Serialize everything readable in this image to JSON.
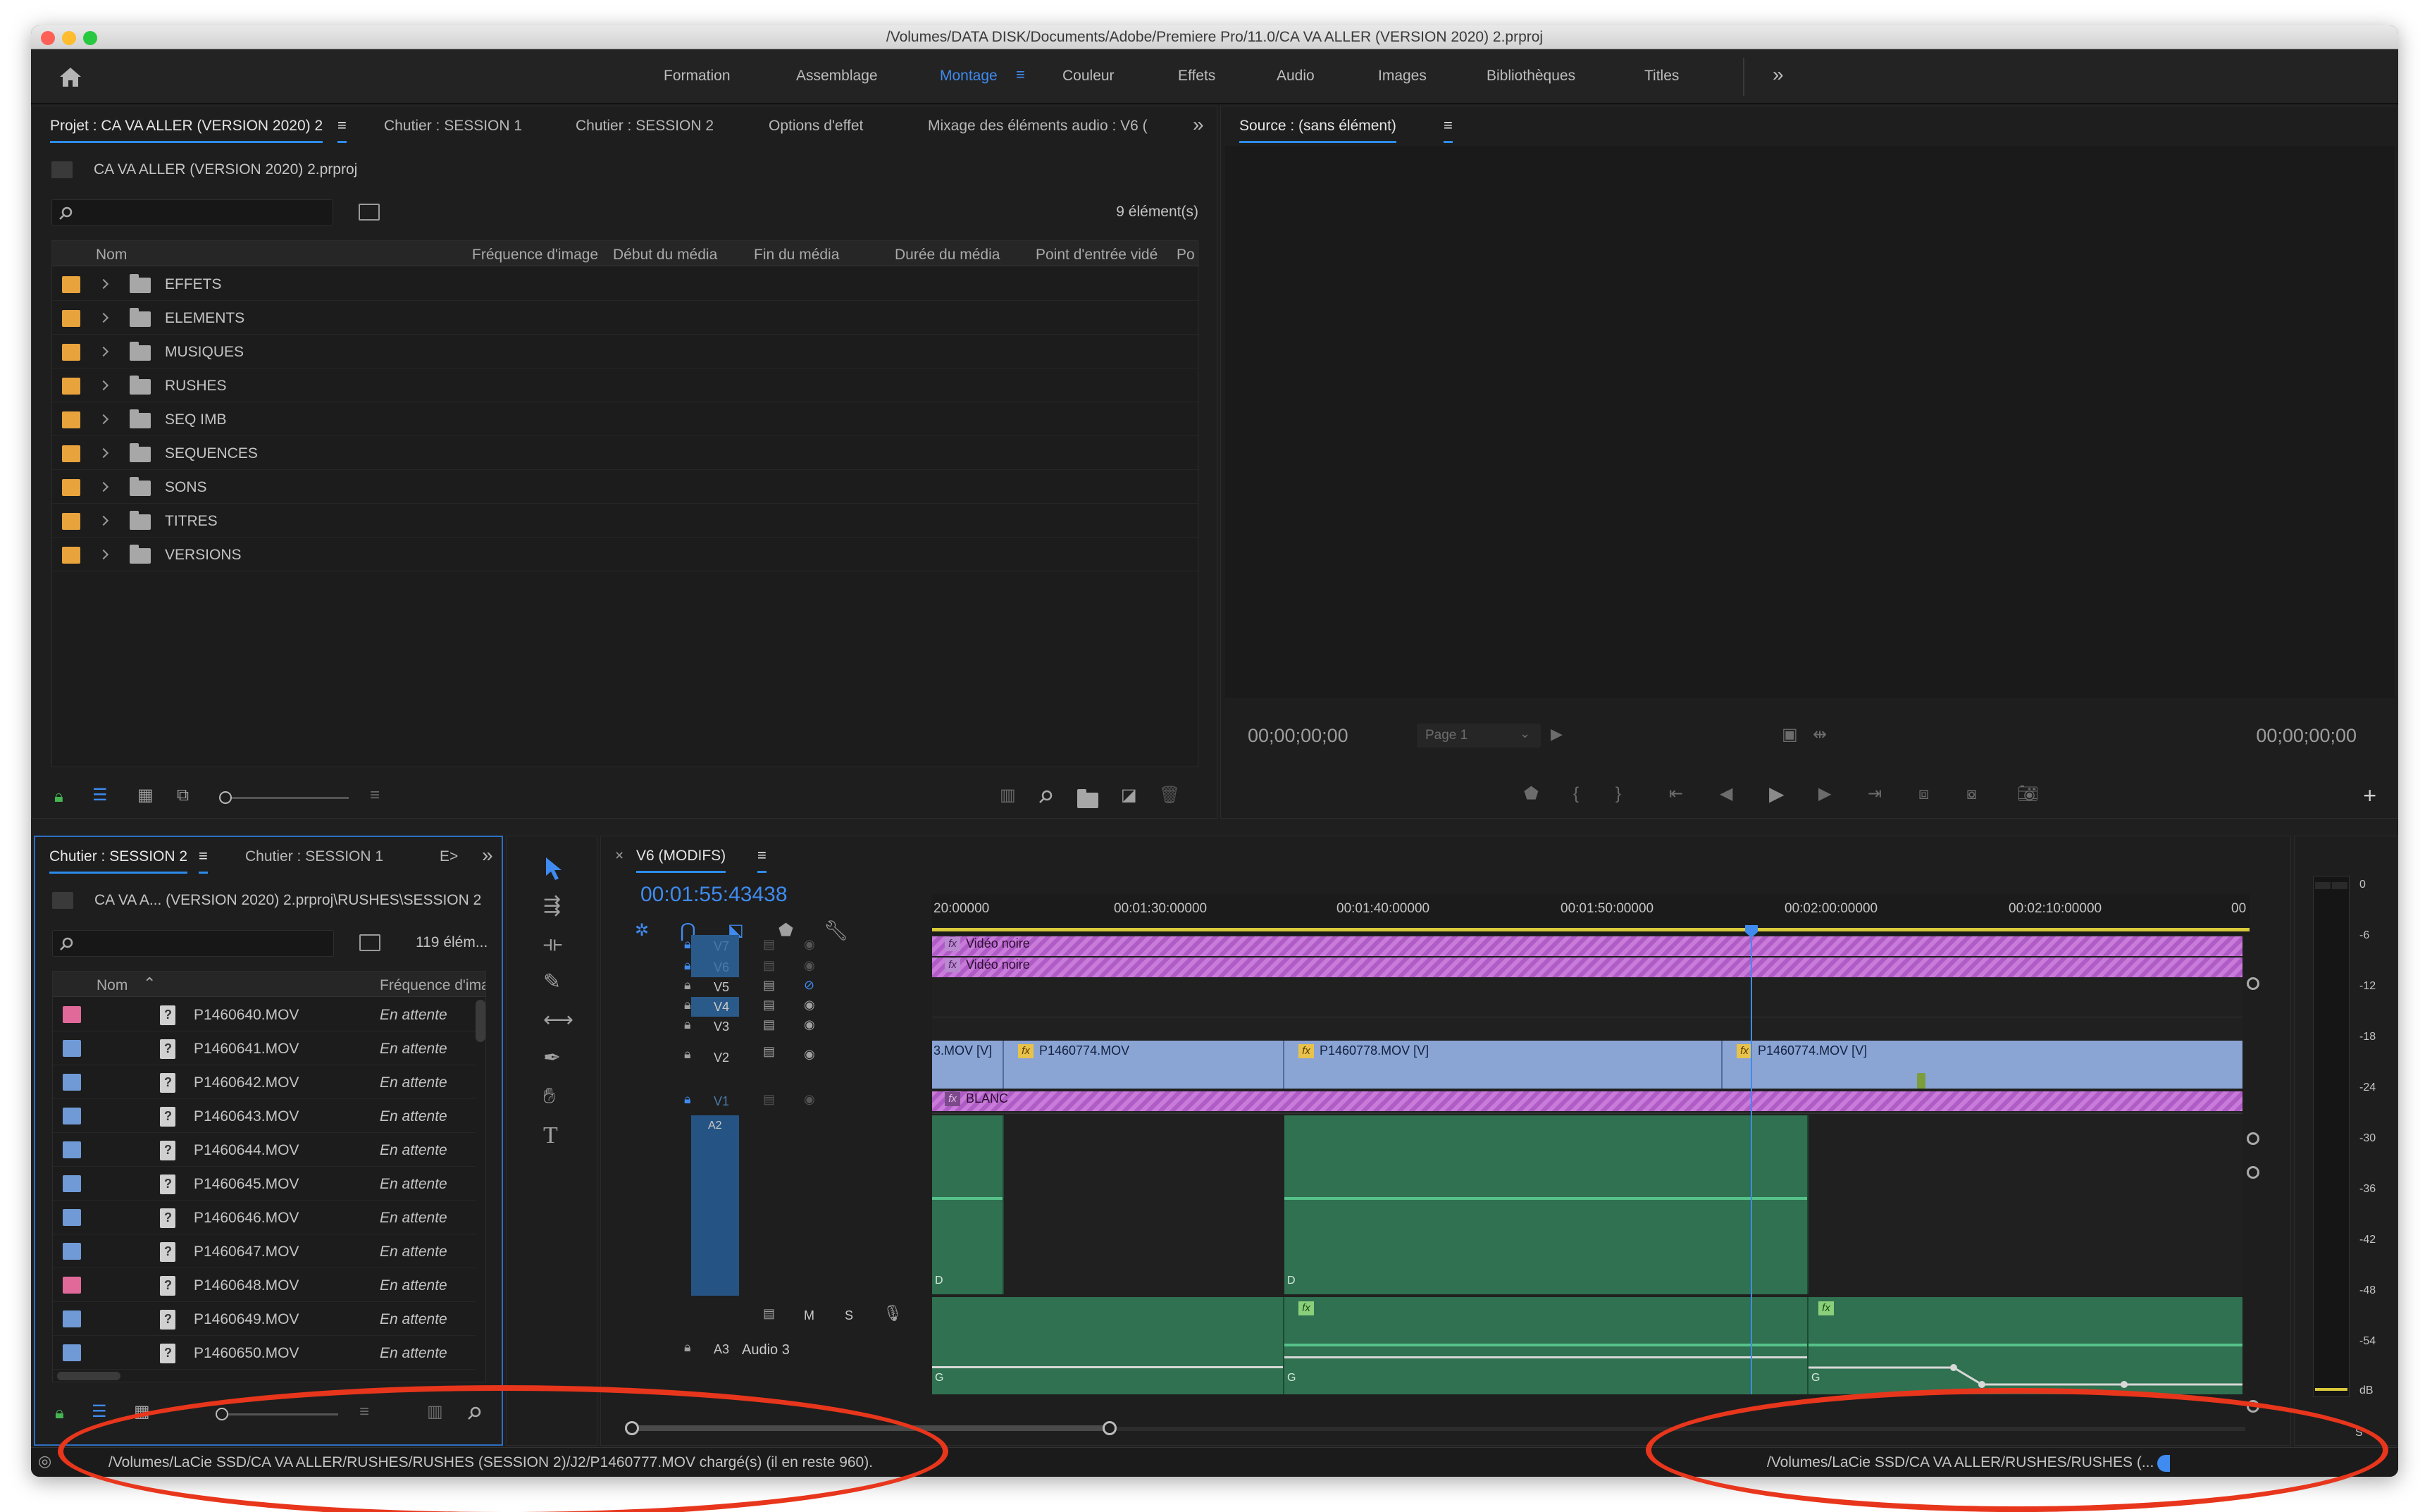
{
  "window": {
    "title": "/Volumes/DATA DISK/Documents/Adobe/Premiere Pro/11.0/CA VA ALLER (VERSION 2020) 2.prproj"
  },
  "workspaces": [
    {
      "label": "Formation"
    },
    {
      "label": "Assemblage"
    },
    {
      "label": "Montage"
    },
    {
      "label": "Couleur"
    },
    {
      "label": "Effets"
    },
    {
      "label": "Audio"
    },
    {
      "label": "Images"
    },
    {
      "label": "Bibliothèques"
    },
    {
      "label": "Titles"
    }
  ],
  "project_panel": {
    "tabs": [
      {
        "label": "Projet : CA VA ALLER (VERSION 2020) 2"
      },
      {
        "label": "Chutier : SESSION 1"
      },
      {
        "label": "Chutier : SESSION 2"
      },
      {
        "label": "Options d'effet"
      },
      {
        "label": "Mixage des éléments audio : V6 ("
      }
    ],
    "file_name": "CA VA ALLER (VERSION 2020) 2.prproj",
    "item_count": "9 élément(s)",
    "columns": [
      "Nom",
      "Fréquence d'image",
      "Début du média",
      "Fin du média",
      "Durée du média",
      "Point d'entrée vidé",
      "Po"
    ],
    "items": [
      {
        "name": "EFFETS"
      },
      {
        "name": "ELEMENTS"
      },
      {
        "name": "MUSIQUES"
      },
      {
        "name": "RUSHES"
      },
      {
        "name": "SEQ IMB"
      },
      {
        "name": "SEQUENCES"
      },
      {
        "name": "SONS"
      },
      {
        "name": "TITRES"
      },
      {
        "name": "VERSIONS"
      }
    ],
    "folder_color": "#e8a33d"
  },
  "source_monitor": {
    "tab": "Source : (sans élément)",
    "timecode_left": "00;00;00;00",
    "timecode_right": "00;00;00;00",
    "page_select": "Page 1"
  },
  "bin_panel": {
    "tabs": [
      {
        "label": "Chutier : SESSION 2"
      },
      {
        "label": "Chutier : SESSION 1"
      },
      {
        "label": "E>"
      }
    ],
    "path": "CA VA A... (VERSION 2020) 2.prproj\\RUSHES\\SESSION 2",
    "item_count": "119 élém...",
    "columns": [
      "Nom",
      "Fréquence d'ima"
    ],
    "items": [
      {
        "name": "P1460640.MOV",
        "status": "En attente",
        "color": "#e0699a"
      },
      {
        "name": "P1460641.MOV",
        "status": "En attente",
        "color": "#6f9ad6"
      },
      {
        "name": "P1460642.MOV",
        "status": "En attente",
        "color": "#6f9ad6"
      },
      {
        "name": "P1460643.MOV",
        "status": "En attente",
        "color": "#6f9ad6"
      },
      {
        "name": "P1460644.MOV",
        "status": "En attente",
        "color": "#6f9ad6"
      },
      {
        "name": "P1460645.MOV",
        "status": "En attente",
        "color": "#6f9ad6"
      },
      {
        "name": "P1460646.MOV",
        "status": "En attente",
        "color": "#6f9ad6"
      },
      {
        "name": "P1460647.MOV",
        "status": "En attente",
        "color": "#6f9ad6"
      },
      {
        "name": "P1460648.MOV",
        "status": "En attente",
        "color": "#e0699a"
      },
      {
        "name": "P1460649.MOV",
        "status": "En attente",
        "color": "#6f9ad6"
      },
      {
        "name": "P1460650.MOV",
        "status": "En attente",
        "color": "#6f9ad6"
      }
    ]
  },
  "timeline": {
    "tab": "V6 (MODIFS)",
    "timecode": "00:01:55:43438",
    "ruler": [
      "20:00000",
      "00:01:30:00000",
      "00:01:40:00000",
      "00:01:50:00000",
      "00:02:00:00000",
      "00:02:10:00000",
      "00"
    ],
    "tracks": {
      "v7": "V7",
      "v6": "V6",
      "v5": "V5",
      "v4": "V4",
      "v3": "V3",
      "v2": "V2",
      "v1": "V1",
      "a2": "A2",
      "a3": "A3",
      "a3_name": "Audio 3",
      "m": "M",
      "s": "S"
    },
    "clips": {
      "v7_clip": "Vidéo noire",
      "v6_clip": "Vidéo noire",
      "v2_c1": "3.MOV [V]",
      "v2_c2": "P1460774.MOV",
      "v2_c3": "P1460778.MOV [V]",
      "v2_c4": "P1460774.MOV [V]",
      "v1_clip": "BLANC",
      "fx": "fx",
      "d_marker": "D",
      "g_marker": "G"
    }
  },
  "meter": {
    "labels": [
      "0",
      "-6",
      "-12",
      "-18",
      "-24",
      "-30",
      "-36",
      "-42",
      "-48",
      "-54",
      "dB"
    ],
    "s": "S"
  },
  "status": {
    "left": "/Volumes/LaCie SSD/CA VA ALLER/RUSHES/RUSHES (SESSION 2)/J2/P1460777.MOV chargé(s) (il en reste 960).",
    "right": "/Volumes/LaCie SSD/CA VA ALLER/RUSHES/RUSHES (..."
  },
  "colors": {
    "accent": "#2d8ceb",
    "annotation": "#e8361c",
    "audio_clip": "#2f7150",
    "video_clip": "#8aa4d4"
  }
}
